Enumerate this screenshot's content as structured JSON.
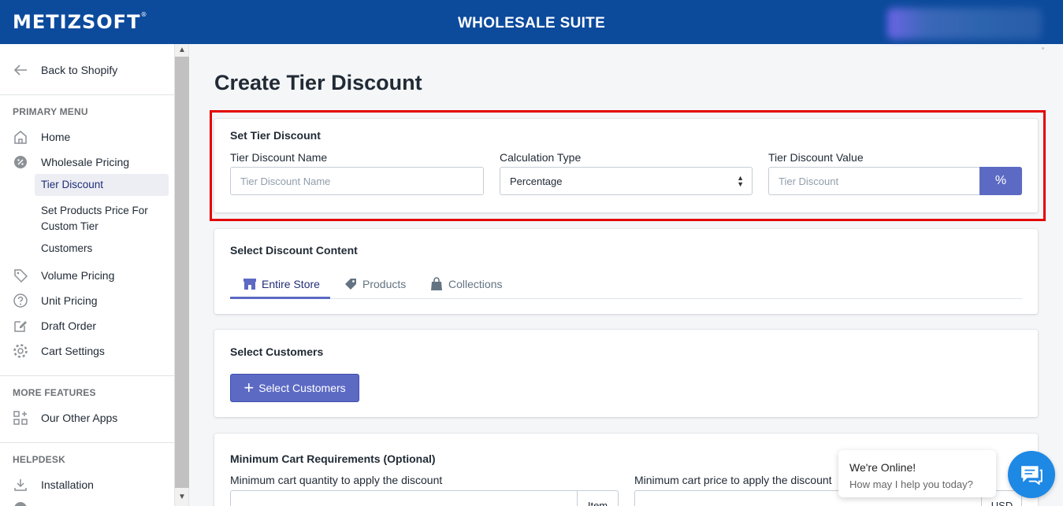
{
  "header": {
    "brand": "METIZSOFT",
    "app_title": "WHOLESALE SUITE"
  },
  "sidebar": {
    "back_label": "Back to Shopify",
    "primary_title": "PRIMARY MENU",
    "home": "Home",
    "wholesale": "Wholesale Pricing",
    "sub_items": [
      "Tier Discount",
      "Set Products Price For Custom Tier",
      "Customers"
    ],
    "volume": "Volume Pricing",
    "unit": "Unit Pricing",
    "draft": "Draft Order",
    "cart": "Cart Settings",
    "more_title": "MORE FEATURES",
    "other_apps": "Our Other Apps",
    "help_title": "HELPDESK",
    "installation": "Installation"
  },
  "page": {
    "title": "Create Tier Discount"
  },
  "tier_card": {
    "title": "Set Tier Discount",
    "name_label": "Tier Discount Name",
    "name_placeholder": "Tier Discount Name",
    "calc_label": "Calculation Type",
    "calc_value": "Percentage",
    "value_label": "Tier Discount Value",
    "value_placeholder": "Tier Discount",
    "value_suffix": "%"
  },
  "content_card": {
    "title": "Select Discount Content",
    "tabs": [
      "Entire Store",
      "Products",
      "Collections"
    ],
    "active_tab": "Entire Store"
  },
  "customers_card": {
    "title": "Select Customers",
    "button": "Select Customers"
  },
  "min_card": {
    "title": "Minimum Cart Requirements (Optional)",
    "qty_label": "Minimum cart quantity to apply the discount",
    "qty_suffix": "Item",
    "price_label": "Minimum cart price to apply the discount",
    "price_suffix": "USD"
  },
  "chat": {
    "status": "We're Online!",
    "prompt": "How may I help you today?"
  },
  "colors": {
    "header": "#0c4a9c",
    "accent": "#5c6ac4",
    "highlight": "#e30000",
    "chat": "#1e88e5"
  }
}
